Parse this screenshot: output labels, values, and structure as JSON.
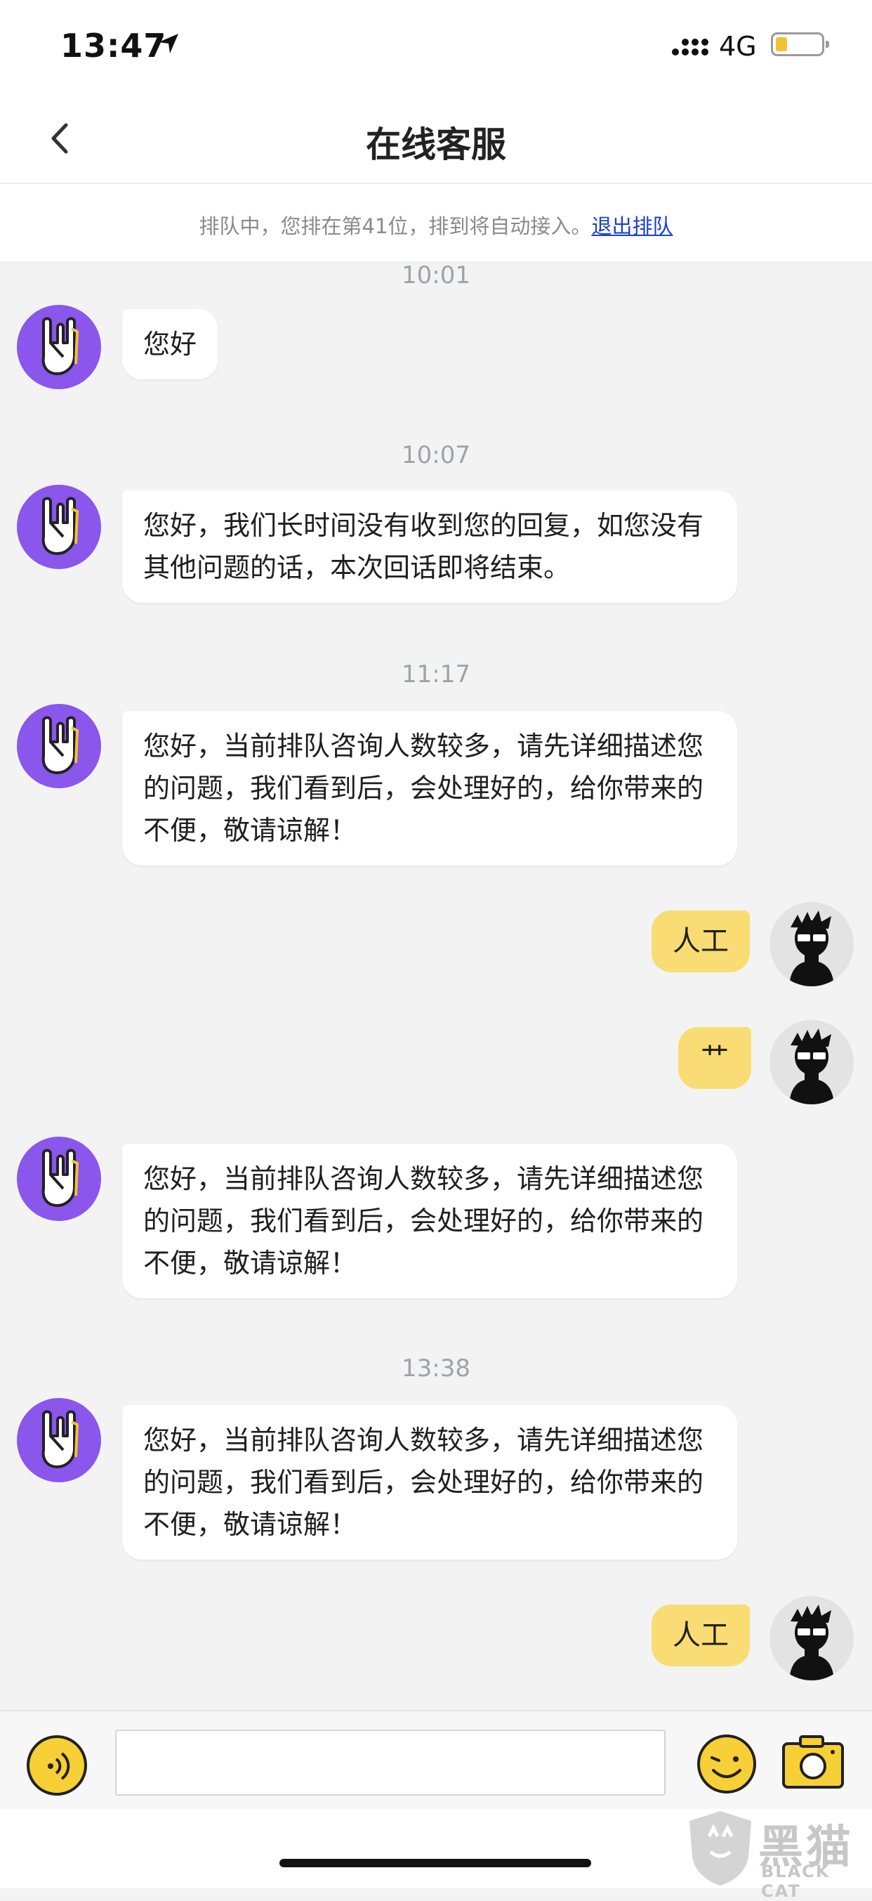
{
  "status_bar": {
    "time": "13:47",
    "network": "4G",
    "icons": [
      "location-arrow-icon",
      "signal-icon",
      "battery-icon"
    ]
  },
  "nav": {
    "title": "在线客服",
    "back_icon": "chevron-left-icon"
  },
  "queue_notice": {
    "text": "排队中，您排在第41位，排到将自动接入。",
    "exit_link": "退出排队"
  },
  "messages": [
    {
      "time": "10:01",
      "from": "agent",
      "text": "您好"
    },
    {
      "time": "10:07",
      "from": "agent",
      "text": "您好，我们长时间没有收到您的回复，如您没有其他问题的话，本次回话即将结束。"
    },
    {
      "time": "11:17",
      "from": "agent",
      "text": "您好，当前排队咨询人数较多，请先详细描述您的问题，我们看到后，会处理好的，给你带来的不便，敬请谅解！"
    },
    {
      "from": "user",
      "text": "人工"
    },
    {
      "from": "user",
      "text": "艹"
    },
    {
      "from": "agent",
      "text": "您好，当前排队咨询人数较多，请先详细描述您的问题，我们看到后，会处理好的，给你带来的不便，敬请谅解！"
    },
    {
      "time": "13:38",
      "from": "agent",
      "text": "您好，当前排队咨询人数较多，请先详细描述您的问题，我们看到后，会处理好的，给你带来的不便，敬请谅解！"
    },
    {
      "from": "user",
      "text": "人工"
    }
  ],
  "input_bar": {
    "text_value": "",
    "icons": [
      "voice-icon",
      "emoji-icon",
      "camera-icon"
    ]
  },
  "watermark": {
    "cn": "黑猫",
    "en": "BLACK CAT"
  },
  "colors": {
    "agent_avatar": "#8a56ec",
    "user_bubble": "#f9dc73",
    "link": "#1a3fcf",
    "chat_bg": "#f3f3f3"
  }
}
